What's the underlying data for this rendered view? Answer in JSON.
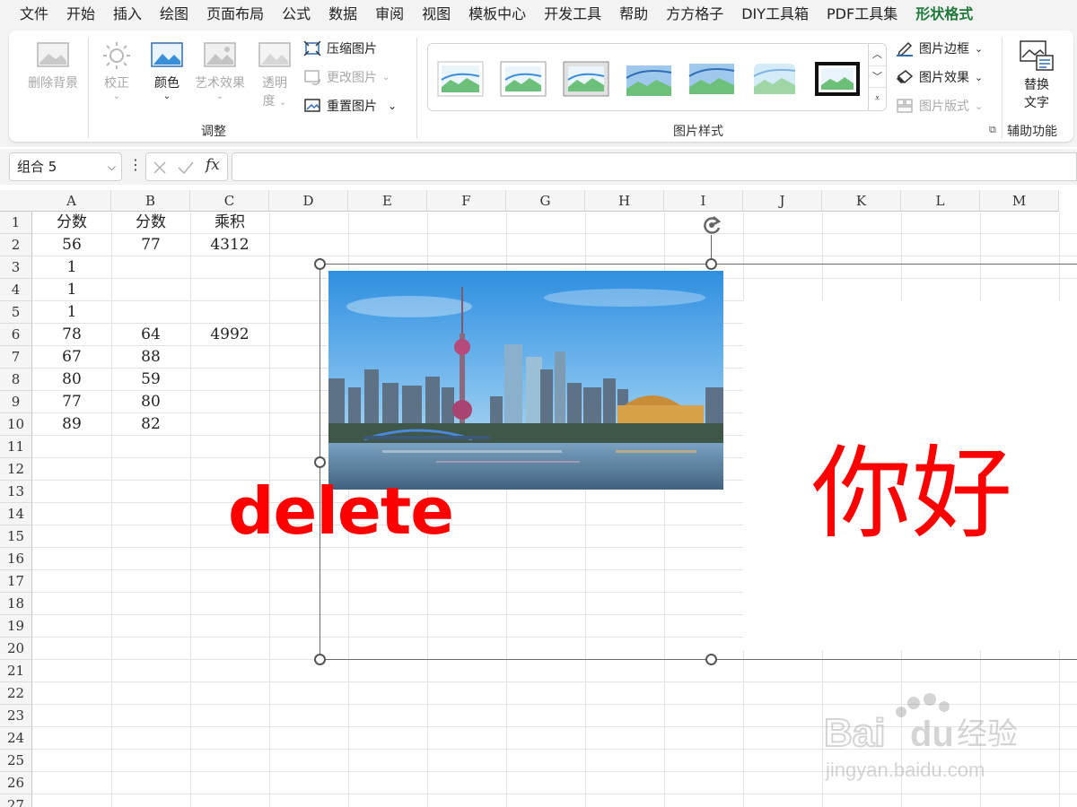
{
  "menu": {
    "items": [
      "文件",
      "开始",
      "插入",
      "绘图",
      "页面布局",
      "公式",
      "数据",
      "审阅",
      "视图",
      "模板中心",
      "开发工具",
      "帮助",
      "方方格子",
      "DIY工具箱",
      "PDF工具集",
      "形状格式"
    ],
    "active": "形状格式"
  },
  "ribbon": {
    "remove_bg": "删除背景",
    "correct": "校正",
    "color": "颜色",
    "art_effects": "艺术效果",
    "transparency_line1": "透明",
    "transparency_line2": "度",
    "compress": "压缩图片",
    "change": "更改图片",
    "reset": "重置图片",
    "adjust_group": "调整",
    "border": "图片边框",
    "effects": "图片效果",
    "layout": "图片版式",
    "styles_group": "图片样式",
    "alt_text_line1": "替换",
    "alt_text_line2": "文字",
    "accessibility_group": "辅助功能"
  },
  "formula_bar": {
    "name_box": "组合 5",
    "fx": "fx",
    "value": ""
  },
  "sheet": {
    "columns": [
      "A",
      "B",
      "C",
      "D",
      "E",
      "F",
      "G",
      "H",
      "I",
      "J",
      "K",
      "L",
      "M"
    ],
    "rows": [
      "1",
      "2",
      "3",
      "4",
      "5",
      "6",
      "7",
      "8",
      "9",
      "10",
      "11",
      "12",
      "13",
      "14",
      "15",
      "16",
      "17",
      "18",
      "19",
      "20",
      "21",
      "22",
      "23",
      "24",
      "25",
      "26",
      "27"
    ],
    "cells": [
      [
        "分数",
        "分数",
        "乘积"
      ],
      [
        "56",
        "77",
        "4312"
      ],
      [
        "1",
        "",
        ""
      ],
      [
        "1",
        "",
        ""
      ],
      [
        "1",
        "",
        ""
      ],
      [
        "78",
        "64",
        "4992"
      ],
      [
        "67",
        "88",
        ""
      ],
      [
        "80",
        "59",
        ""
      ],
      [
        "77",
        "80",
        ""
      ],
      [
        "89",
        "82",
        ""
      ]
    ]
  },
  "overlay": {
    "delete_label": "delete",
    "hello_label": "你好",
    "accent_color": "#ff0000"
  },
  "watermark": {
    "brand": "Baidu经验",
    "url": "jingyan.baidu.com"
  }
}
